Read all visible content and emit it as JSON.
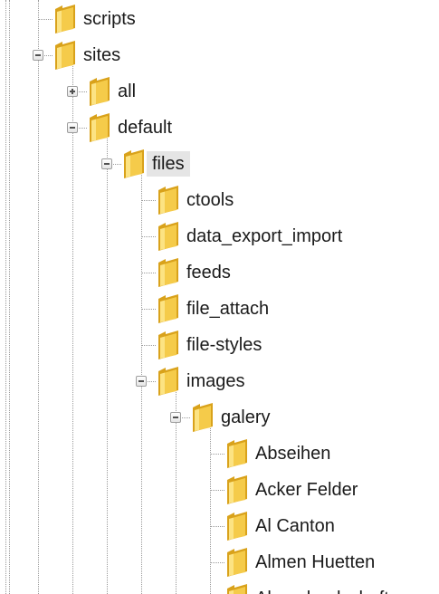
{
  "tree": {
    "nodes": [
      {
        "label": "scripts",
        "level": 0,
        "state": "leaf",
        "last": false,
        "selected": false
      },
      {
        "label": "sites",
        "level": 0,
        "state": "expanded",
        "last": false,
        "selected": false
      },
      {
        "label": "all",
        "level": 1,
        "state": "collapsed",
        "last": false,
        "selected": false
      },
      {
        "label": "default",
        "level": 1,
        "state": "expanded",
        "last": false,
        "selected": false
      },
      {
        "label": "files",
        "level": 2,
        "state": "expanded",
        "last": false,
        "selected": true
      },
      {
        "label": "ctools",
        "level": 3,
        "state": "leaf",
        "last": false,
        "selected": false
      },
      {
        "label": "data_export_import",
        "level": 3,
        "state": "leaf",
        "last": false,
        "selected": false
      },
      {
        "label": "feeds",
        "level": 3,
        "state": "leaf",
        "last": false,
        "selected": false
      },
      {
        "label": "file_attach",
        "level": 3,
        "state": "leaf",
        "last": false,
        "selected": false
      },
      {
        "label": "file-styles",
        "level": 3,
        "state": "leaf",
        "last": false,
        "selected": false
      },
      {
        "label": "images",
        "level": 3,
        "state": "expanded",
        "last": false,
        "selected": false
      },
      {
        "label": "galery",
        "level": 4,
        "state": "expanded",
        "last": false,
        "selected": false
      },
      {
        "label": "Abseihen",
        "level": 5,
        "state": "leaf",
        "last": false,
        "selected": false
      },
      {
        "label": "Acker Felder",
        "level": 5,
        "state": "leaf",
        "last": false,
        "selected": false
      },
      {
        "label": "Al Canton",
        "level": 5,
        "state": "leaf",
        "last": false,
        "selected": false
      },
      {
        "label": "Almen Huetten",
        "level": 5,
        "state": "leaf",
        "last": false,
        "selected": false
      },
      {
        "label": "Almenlandschaft",
        "level": 5,
        "state": "leaf",
        "last": false,
        "selected": false
      }
    ]
  },
  "colors": {
    "dotted_line": "#9a9a9a",
    "selected_bg": "#e5e5e5",
    "folder_body": "#f5cb4a",
    "folder_dark": "#d9a21b",
    "folder_light": "#fde58a"
  },
  "icons": {
    "folder": "folder-icon",
    "expand": "plus-expander-icon",
    "collapse": "minus-expander-icon"
  }
}
